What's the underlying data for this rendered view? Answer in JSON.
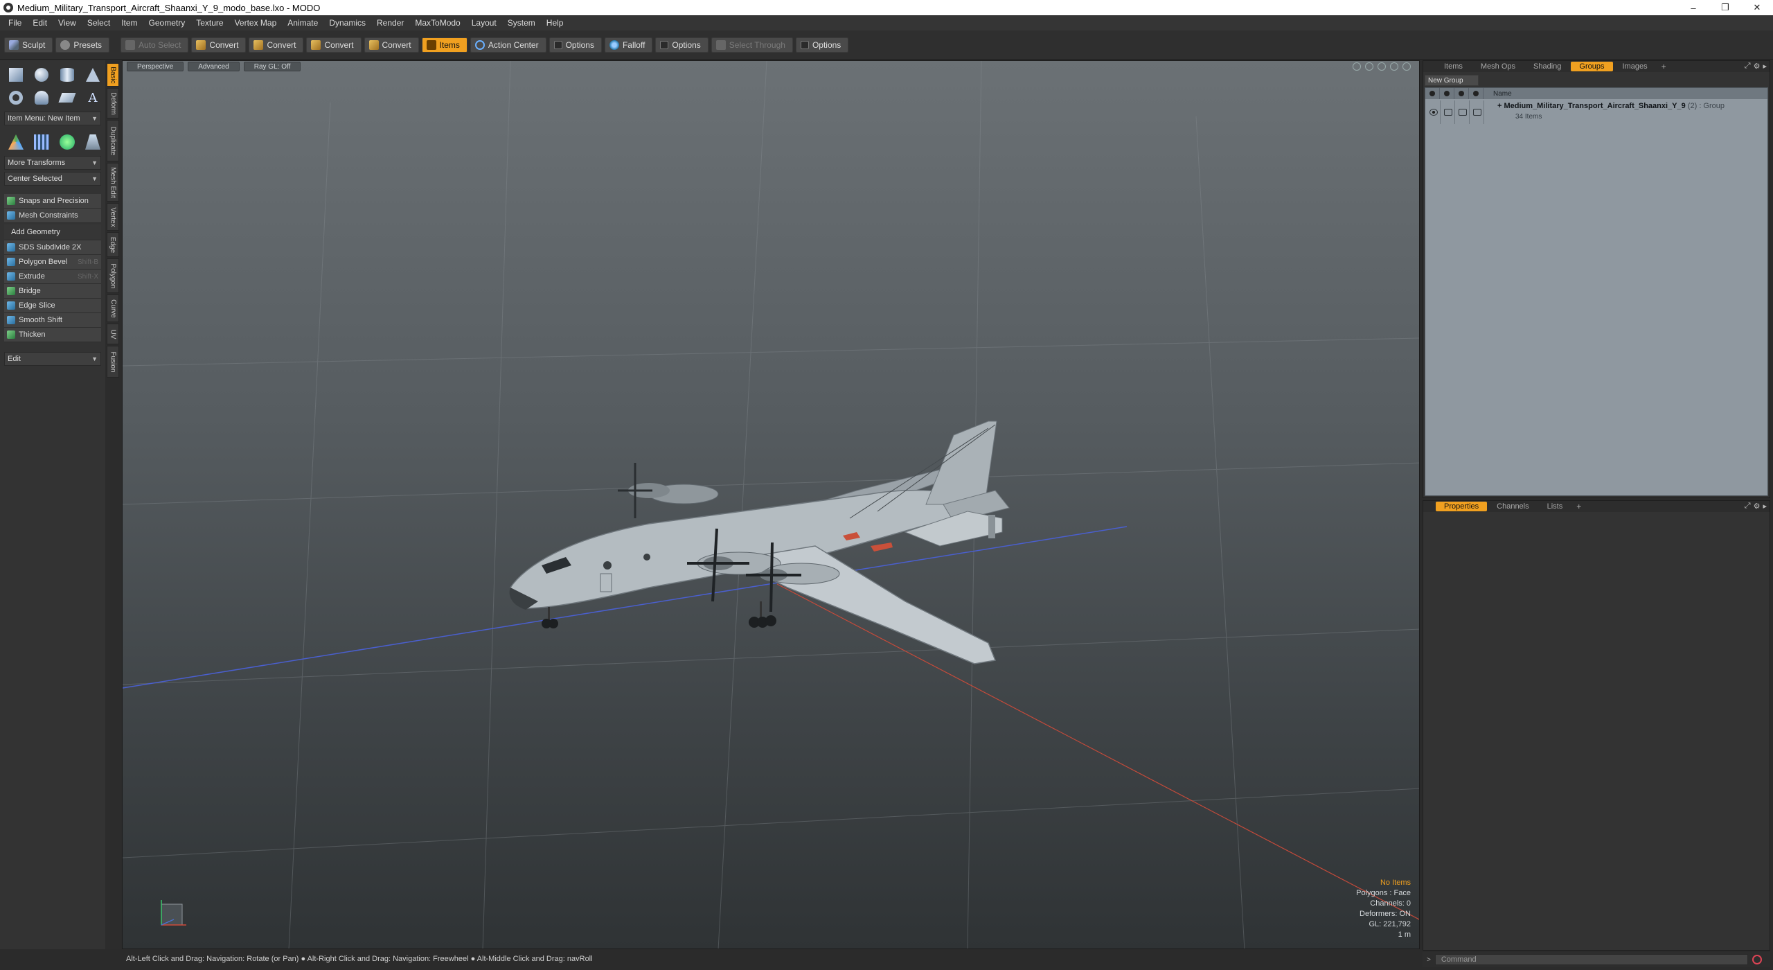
{
  "window": {
    "title": "Medium_Military_Transport_Aircraft_Shaanxi_Y_9_modo_base.lxo - MODO",
    "controls": [
      "–",
      "❐",
      "✕"
    ]
  },
  "menu": [
    "File",
    "Edit",
    "View",
    "Select",
    "Item",
    "Geometry",
    "Texture",
    "Vertex Map",
    "Animate",
    "Dynamics",
    "Render",
    "MaxToModo",
    "Layout",
    "System",
    "Help"
  ],
  "toolbar": {
    "sculpt": "Sculpt",
    "presets": "Presets",
    "auto_select": "Auto Select",
    "convert1": "Convert",
    "convert2": "Convert",
    "convert3": "Convert",
    "convert4": "Convert",
    "items": "Items",
    "action_center": "Action Center",
    "options1": "Options",
    "falloff": "Falloff",
    "options2": "Options",
    "select_through": "Select Through",
    "options3": "Options"
  },
  "toolbox": {
    "item_menu": "Item Menu: New Item",
    "more_transforms": "More Transforms",
    "center_selected": "Center Selected",
    "snaps": "Snaps and Precision",
    "mesh_constraints": "Mesh Constraints",
    "add_geometry": "Add Geometry",
    "tools": [
      {
        "label": "SDS Subdivide 2X",
        "shortcut": ""
      },
      {
        "label": "Polygon Bevel",
        "shortcut": "Shift-B"
      },
      {
        "label": "Extrude",
        "shortcut": "Shift-X"
      },
      {
        "label": "Bridge",
        "shortcut": ""
      },
      {
        "label": "Edge Slice",
        "shortcut": ""
      },
      {
        "label": "Smooth Shift",
        "shortcut": ""
      },
      {
        "label": "Thicken",
        "shortcut": ""
      }
    ],
    "edit": "Edit"
  },
  "vtabs": [
    "Basic",
    "Deform",
    "Duplicate",
    "Mesh Edit",
    "Vertex",
    "Edge",
    "Polygon",
    "Curve",
    "UV",
    "Fusion"
  ],
  "viewport": {
    "tabs": [
      "Perspective",
      "Advanced",
      "Ray GL: Off"
    ],
    "info": {
      "no_items": "No Items",
      "polygons": "Polygons : Face",
      "channels": "Channels: 0",
      "deformers": "Deformers: ON",
      "gl": "GL: 221,792",
      "unit": "1 m"
    }
  },
  "statusbar": "Alt-Left Click and Drag: Navigation: Rotate (or Pan) ● Alt-Right Click and Drag: Navigation: Freewheel ● Alt-Middle Click and Drag: navRoll",
  "groups_panel": {
    "tabs": [
      "Items",
      "Mesh Ops",
      "Shading",
      "Groups",
      "Images"
    ],
    "new_group": "New Group",
    "column_name": "Name",
    "group_name": "Medium_Military_Transport_Aircraft_Shaanxi_Y_9",
    "group_count": "(2) : Group",
    "group_sub": "34 Items"
  },
  "properties_panel": {
    "tabs": [
      "Properties",
      "Channels",
      "Lists"
    ]
  },
  "command": {
    "placeholder": "Command"
  }
}
